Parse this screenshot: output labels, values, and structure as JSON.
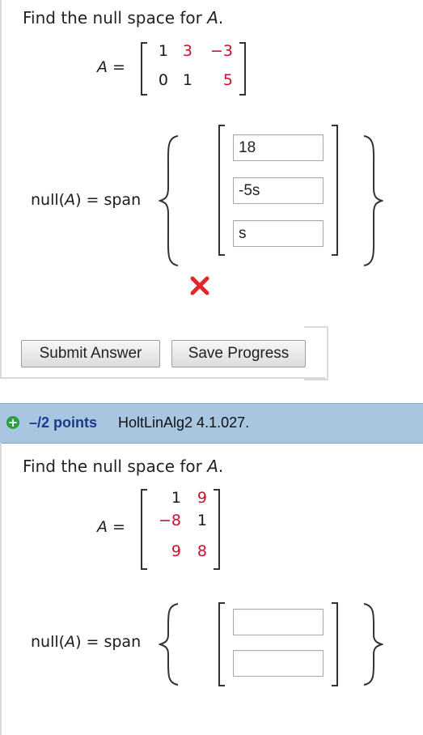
{
  "q1": {
    "prompt_prefix": "Find the null space for ",
    "prompt_var": "A",
    "prompt_suffix": ".",
    "matrix_label": "A =",
    "matrix": [
      [
        "1",
        "3",
        "−3"
      ],
      [
        "0",
        "1",
        "5"
      ]
    ],
    "null_label_prefix": "null(",
    "null_label_var": "A",
    "null_label_suffix": ") = span",
    "answers": [
      "18",
      "-5s",
      "s"
    ],
    "result_icon": "x-mark-icon",
    "result_color": "#e0262b",
    "submit_label": "Submit Answer",
    "save_label": "Save Progress"
  },
  "q2": {
    "points_label": "–/2 points",
    "question_id": "HoltLinAlg2 4.1.027.",
    "expand_icon": "plus-circle-icon",
    "prompt_prefix": "Find the null space for ",
    "prompt_var": "A",
    "prompt_suffix": ".",
    "matrix_label": "A =",
    "matrix": [
      [
        "1",
        "9"
      ],
      [
        "−8",
        "1"
      ],
      [
        "",
        "9",
        "8"
      ]
    ],
    "null_label_prefix": "null(",
    "null_label_var": "A",
    "null_label_suffix": ") = span",
    "answers": [
      "",
      ""
    ]
  },
  "colors": {
    "header_bg": "#a8c6e0",
    "red_entries": "#c8102e",
    "points_text": "#1b3a8c"
  }
}
